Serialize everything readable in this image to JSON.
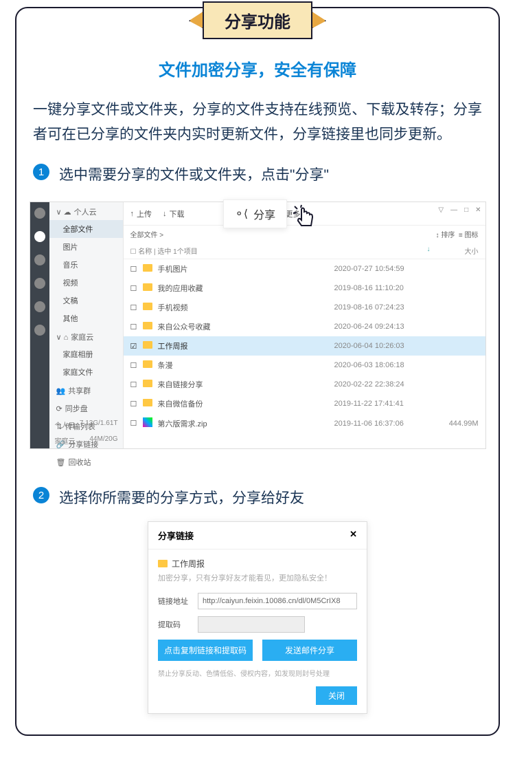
{
  "banner": "分享功能",
  "section_title": "文件加密分享，安全有保障",
  "description": "一键分享文件或文件夹，分享的文件支持在线预览、下载及转存；分享者可在已分享的文件夹内实时更新文件，分享链接里也同步更新。",
  "steps": [
    {
      "num": "1",
      "text": "选中需要分享的文件或文件夹，点击\"分享\""
    },
    {
      "num": "2",
      "text": "选择你所需要的分享方式，分享给好友"
    }
  ],
  "fm": {
    "sidebar": {
      "personal_cloud": "个人云",
      "items": [
        "全部文件",
        "图片",
        "音乐",
        "视频",
        "文稿",
        "其他"
      ],
      "family_cloud": "家庭云",
      "family_items": [
        "家庭相册",
        "家庭文件"
      ],
      "share_group": "共享群",
      "sync": "同步盘",
      "transfer": "传输列表",
      "share_link": "分享链接",
      "recycle": "回收站",
      "storage1": {
        "label": "个人云",
        "value": "7.13G/1.61T"
      },
      "storage2": {
        "label": "家庭云",
        "value": "44M/20G"
      }
    },
    "toolbar": {
      "upload": "上传",
      "download": "下载",
      "share": "分享",
      "more": "更多"
    },
    "headers": {
      "sort": "排序",
      "icon": "图标",
      "breadcrumb": "全部文件 >",
      "name": "名称",
      "selected": "选中 1个项目",
      "size": "大小"
    },
    "rows": [
      {
        "name": "手机图片",
        "date": "2020-07-27 10:54:59",
        "size": "",
        "type": "folder"
      },
      {
        "name": "我的应用收藏",
        "date": "2019-08-16 11:10:20",
        "size": "",
        "type": "folder"
      },
      {
        "name": "手机视频",
        "date": "2019-08-16 07:24:23",
        "size": "",
        "type": "folder"
      },
      {
        "name": "来自公众号收藏",
        "date": "2020-06-24 09:24:13",
        "size": "",
        "type": "folder"
      },
      {
        "name": "工作周报",
        "date": "2020-06-04 10:26:03",
        "size": "",
        "type": "folder",
        "selected": true
      },
      {
        "name": "条漫",
        "date": "2020-06-03 18:06:18",
        "size": "",
        "type": "folder"
      },
      {
        "name": "来自链接分享",
        "date": "2020-02-22 22:38:24",
        "size": "",
        "type": "folder"
      },
      {
        "name": "来自微信备份",
        "date": "2019-11-22 17:41:41",
        "size": "",
        "type": "folder"
      },
      {
        "name": "第六版需求.zip",
        "date": "2019-11-06 16:37:06",
        "size": "444.99M",
        "type": "zip"
      }
    ]
  },
  "dialog": {
    "title": "分享链接",
    "file": "工作周报",
    "subtitle": "加密分享，只有分享好友才能看见，更加隐私安全！",
    "link_label": "链接地址",
    "link_value": "http://caiyun.feixin.10086.cn/dl/0M5CrIX8",
    "code_label": "提取码",
    "code_value": "",
    "btn_copy": "点击复制链接和提取码",
    "btn_mail": "发送邮件分享",
    "warning": "禁止分享反动、色情低俗、侵权内容，如发现则封号处理",
    "close": "关闭"
  }
}
